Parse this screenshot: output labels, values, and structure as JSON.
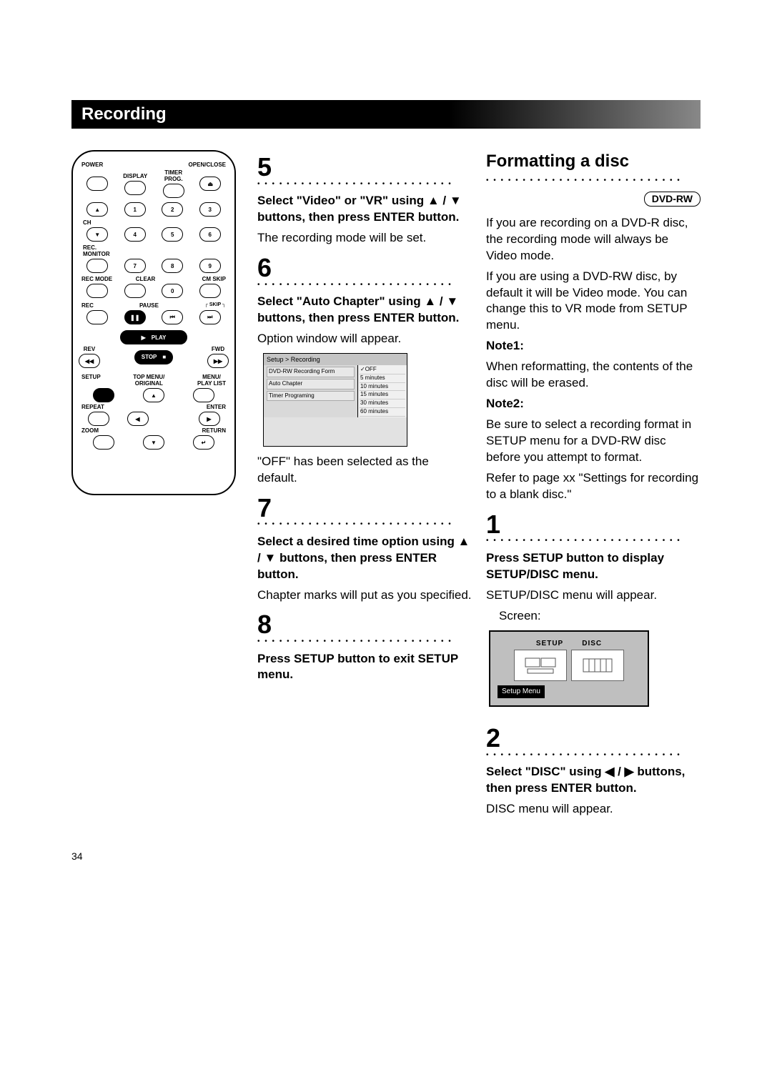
{
  "header": "Recording",
  "page_number": "34",
  "remote": {
    "power": "POWER",
    "display": "DISPLAY",
    "timer_prog": "TIMER\nPROG.",
    "open_close": "OPEN/CLOSE",
    "ch": "CH",
    "rec_monitor": "REC.\nMONITOR",
    "rec_mode": "REC MODE",
    "clear": "CLEAR",
    "cm_skip": "CM SKIP",
    "rec": "REC",
    "pause": "PAUSE",
    "skip": "SKIP",
    "play": "PLAY",
    "rev": "REV",
    "fwd": "FWD",
    "stop": "STOP",
    "setup": "SETUP",
    "top_menu": "TOP MENU/\nORIGINAL",
    "menu_playlist": "MENU/\nPLAY LIST",
    "repeat": "REPEAT",
    "enter": "ENTER",
    "zoom": "ZOOM",
    "return": "RETURN",
    "digits": [
      "1",
      "2",
      "3",
      "4",
      "5",
      "6",
      "7",
      "8",
      "9",
      "0"
    ]
  },
  "steps_mid": {
    "s5": {
      "num": "5",
      "bold": "Select \"Video\" or \"VR\" using ▲ / ▼ buttons, then press ENTER button.",
      "body": "The recording mode will be set."
    },
    "s6": {
      "num": "6",
      "bold": "Select \"Auto Chapter\" using ▲ / ▼ buttons, then press ENTER button.",
      "body": "Option window will appear.",
      "after": "\"OFF\" has been selected as the default."
    },
    "s7": {
      "num": "7",
      "bold": "Select a desired time option using ▲ / ▼ buttons, then press ENTER button.",
      "body": "Chapter marks will put as you specified."
    },
    "s8": {
      "num": "8",
      "bold": "Press SETUP button to exit SETUP menu."
    }
  },
  "option_window": {
    "title": "Setup > Recording",
    "rows": [
      "DVD-RW Recording Form",
      "Auto Chapter",
      "Timer Programing"
    ],
    "options": [
      "✓OFF",
      "5 minutes",
      "10 minutes",
      "15 minutes",
      "30 minutes",
      "60 minutes"
    ]
  },
  "right": {
    "title": "Formatting a disc",
    "badge": "DVD-RW",
    "intro1": "If you are recording on a DVD-R disc, the recording mode will always be Video mode.",
    "intro2": "If you are using a DVD-RW disc, by default it will be Video mode. You can change this to VR mode from SETUP menu.",
    "note1_label": "Note1:",
    "note1": "When reformatting, the contents of the disc will be erased.",
    "note2_label": "Note2:",
    "note2a": "Be sure to select a recording format in SETUP menu for a DVD-RW disc before you attempt to format.",
    "note2b": "Refer to page xx \"Settings for recording to a blank disc.\"",
    "s1": {
      "num": "1",
      "bold": "Press SETUP button to display SETUP/DISC menu.",
      "body1": "SETUP/DISC menu will appear.",
      "body2": "Screen:"
    },
    "s2": {
      "num": "2",
      "bold": "Select \"DISC\" using ◀ / ▶ buttons, then press ENTER button.",
      "body": "DISC menu will appear."
    }
  },
  "setup_screen": {
    "tab1": "SETUP",
    "tab2": "DISC",
    "caption": "Setup Menu"
  }
}
